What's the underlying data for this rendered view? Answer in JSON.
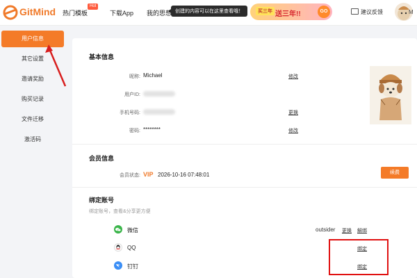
{
  "header": {
    "logo_text": "GitMind",
    "nav": [
      {
        "label": "热门模板"
      },
      {
        "label": "下载App"
      },
      {
        "label": "我的思想"
      }
    ],
    "hot_badge": "Hot",
    "tooltip": "创建的内容可以在这里查看哦！",
    "promo": {
      "tag": "买三年",
      "text": "送三年!!",
      "go": "GO"
    },
    "feedback_label": "建议反馈",
    "avatar_label": "M"
  },
  "sidebar": {
    "items": [
      {
        "label": "用户信息",
        "active": true
      },
      {
        "label": "其它设置"
      },
      {
        "label": "邀请奖励"
      },
      {
        "label": "购买记录"
      },
      {
        "label": "文件迁移"
      },
      {
        "label": "激活码"
      }
    ]
  },
  "basic": {
    "title": "基本信息",
    "nickname_label": "昵称:",
    "nickname": "Michael",
    "nickname_edit": "修改",
    "uid_label": "用户ID:",
    "phone_label": "手机号码:",
    "phone_change": "更换",
    "password_label": "密码:",
    "password": "********",
    "password_edit": "修改"
  },
  "member": {
    "title": "会员信息",
    "status_label": "会员状态:",
    "vip": "VIP",
    "expire": "2026-10-16 07:48:01",
    "renew_label": "续费"
  },
  "bind": {
    "title": "绑定账号",
    "subtitle": "绑定账号，查看&分享更方便",
    "accounts": [
      {
        "name": "微信",
        "user": "outsider",
        "change": "更换",
        "unbind": "解绑"
      },
      {
        "name": "QQ",
        "bind": "绑定"
      },
      {
        "name": "钉钉",
        "bind": "绑定"
      }
    ]
  },
  "colors": {
    "accent": "#f47b28",
    "highlight": "#e01010"
  }
}
